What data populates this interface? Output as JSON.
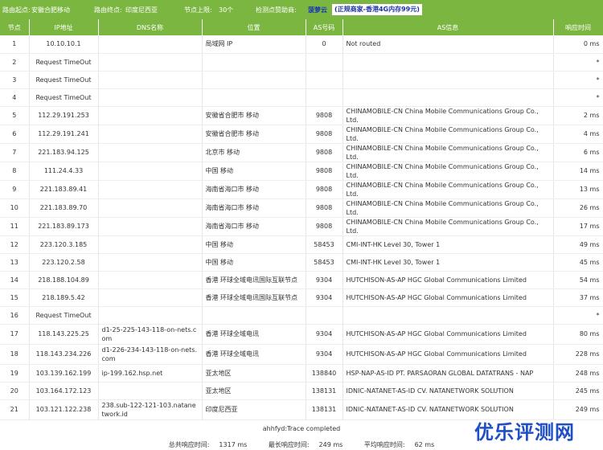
{
  "header": {
    "origin_label": "路由起点:",
    "origin": "安徽合肥移动",
    "dest_label": "路由终点:",
    "dest": "印度尼西亚",
    "hops_label": "节点上限:",
    "hops": "30个",
    "sponsor_label": "检测点赞助商:",
    "sponsor": "菠萝云",
    "ad": "(正规商家-香港4G内存99元)"
  },
  "columns": [
    "节点",
    "IP地址",
    "DNS名称",
    "位置",
    "AS号码",
    "AS信息",
    "响应时间"
  ],
  "rows": [
    {
      "n": "1",
      "ip": "10.10.10.1",
      "dns": "",
      "loc": "局域网 IP",
      "as": "0",
      "asinfo": "Not routed",
      "time": "0 ms"
    },
    {
      "n": "2",
      "ip": "Request TimeOut",
      "dns": "",
      "loc": "",
      "as": "",
      "asinfo": "",
      "time": "*"
    },
    {
      "n": "3",
      "ip": "Request TimeOut",
      "dns": "",
      "loc": "",
      "as": "",
      "asinfo": "",
      "time": "*"
    },
    {
      "n": "4",
      "ip": "Request TimeOut",
      "dns": "",
      "loc": "",
      "as": "",
      "asinfo": "",
      "time": "*"
    },
    {
      "n": "5",
      "ip": "112.29.191.253",
      "dns": "",
      "loc": "安徽省合肥市 移动",
      "as": "9808",
      "asinfo": "CHINAMOBILE-CN China Mobile Communications Group Co., Ltd.",
      "time": "2 ms"
    },
    {
      "n": "6",
      "ip": "112.29.191.241",
      "dns": "",
      "loc": "安徽省合肥市 移动",
      "as": "9808",
      "asinfo": "CHINAMOBILE-CN China Mobile Communications Group Co., Ltd.",
      "time": "4 ms"
    },
    {
      "n": "7",
      "ip": "221.183.94.125",
      "dns": "",
      "loc": "北京市 移动",
      "as": "9808",
      "asinfo": "CHINAMOBILE-CN China Mobile Communications Group Co., Ltd.",
      "time": "6 ms"
    },
    {
      "n": "8",
      "ip": "111.24.4.33",
      "dns": "",
      "loc": "中国 移动",
      "as": "9808",
      "asinfo": "CHINAMOBILE-CN China Mobile Communications Group Co., Ltd.",
      "time": "14 ms"
    },
    {
      "n": "9",
      "ip": "221.183.89.41",
      "dns": "",
      "loc": "海南省海口市 移动",
      "as": "9808",
      "asinfo": "CHINAMOBILE-CN China Mobile Communications Group Co., Ltd.",
      "time": "13 ms"
    },
    {
      "n": "10",
      "ip": "221.183.89.70",
      "dns": "",
      "loc": "海南省海口市 移动",
      "as": "9808",
      "asinfo": "CHINAMOBILE-CN China Mobile Communications Group Co., Ltd.",
      "time": "26 ms"
    },
    {
      "n": "11",
      "ip": "221.183.89.173",
      "dns": "",
      "loc": "海南省海口市 移动",
      "as": "9808",
      "asinfo": "CHINAMOBILE-CN China Mobile Communications Group Co., Ltd.",
      "time": "17 ms"
    },
    {
      "n": "12",
      "ip": "223.120.3.185",
      "dns": "",
      "loc": "中国 移动",
      "as": "58453",
      "asinfo": "CMI-INT-HK Level 30, Tower 1",
      "time": "49 ms"
    },
    {
      "n": "13",
      "ip": "223.120.2.58",
      "dns": "",
      "loc": "中国 移动",
      "as": "58453",
      "asinfo": "CMI-INT-HK Level 30, Tower 1",
      "time": "45 ms"
    },
    {
      "n": "14",
      "ip": "218.188.104.89",
      "dns": "",
      "loc": "香港 环球全域电讯国际互联节点",
      "as": "9304",
      "asinfo": "HUTCHISON-AS-AP HGC Global Communications Limited",
      "time": "54 ms"
    },
    {
      "n": "15",
      "ip": "218.189.5.42",
      "dns": "",
      "loc": "香港 环球全域电讯国际互联节点",
      "as": "9304",
      "asinfo": "HUTCHISON-AS-AP HGC Global Communications Limited",
      "time": "37 ms"
    },
    {
      "n": "16",
      "ip": "Request TimeOut",
      "dns": "",
      "loc": "",
      "as": "",
      "asinfo": "",
      "time": "*"
    },
    {
      "n": "17",
      "ip": "118.143.225.25",
      "dns": "d1-25-225-143-118-on-nets.com",
      "loc": "香港 环球全域电讯",
      "as": "9304",
      "asinfo": "HUTCHISON-AS-AP HGC Global Communications Limited",
      "time": "80 ms"
    },
    {
      "n": "18",
      "ip": "118.143.234.226",
      "dns": "d1-226-234-143-118-on-nets.com",
      "loc": "香港 环球全域电讯",
      "as": "9304",
      "asinfo": "HUTCHISON-AS-AP HGC Global Communications Limited",
      "time": "228 ms"
    },
    {
      "n": "19",
      "ip": "103.139.162.199",
      "dns": "ip-199.162.hsp.net",
      "loc": "亚太地区",
      "as": "138840",
      "asinfo": "HSP-NAP-AS-ID PT. PARSAORAN GLOBAL DATATRANS - NAP",
      "time": "248 ms"
    },
    {
      "n": "20",
      "ip": "103.164.172.123",
      "dns": "",
      "loc": "亚太地区",
      "as": "138131",
      "asinfo": "IDNIC-NATANET-AS-ID CV. NATANETWORK SOLUTION",
      "time": "245 ms"
    },
    {
      "n": "21",
      "ip": "103.121.122.238",
      "dns": "238.sub-122-121-103.natanetwork.id",
      "loc": "印度尼西亚",
      "as": "138131",
      "asinfo": "IDNIC-NATANET-AS-ID CV. NATANETWORK SOLUTION",
      "time": "249 ms"
    }
  ],
  "footer": {
    "status": "ahhfyd:Trace completed",
    "total_label": "总共响应时间:",
    "total": "1317 ms",
    "max_label": "最长响应时间:",
    "max": "249 ms",
    "avg_label": "平均响应时间:",
    "avg": "62 ms"
  },
  "watermark": "优乐评测网",
  "colors": {
    "header_green": "#7bb641",
    "sponsor_blue": "#1836b8",
    "watermark_blue": "#1f4fc4"
  }
}
